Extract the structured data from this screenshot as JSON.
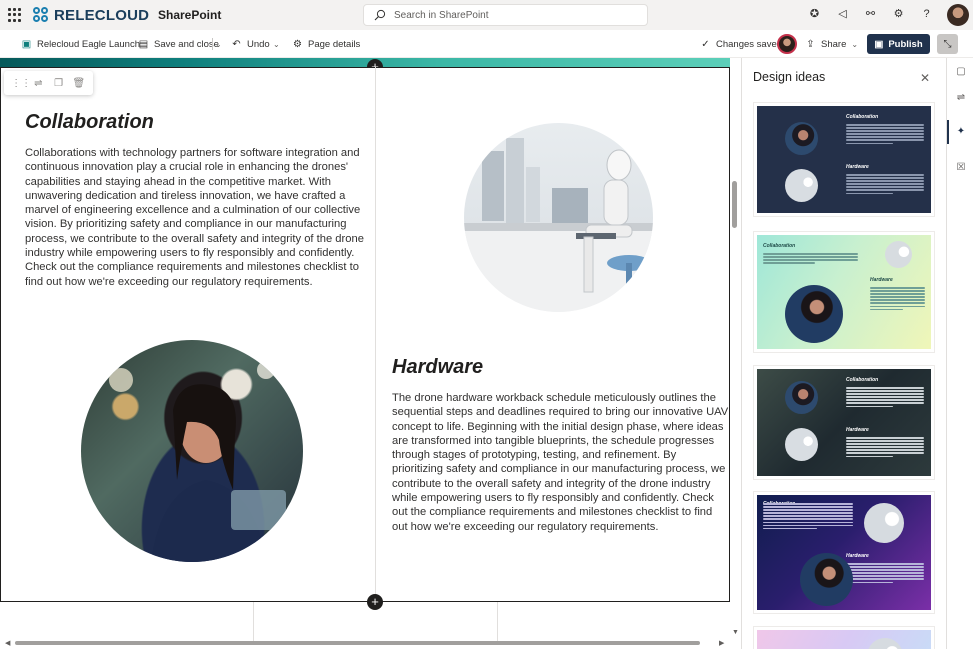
{
  "suite": {
    "brand": "RELECLOUD",
    "app": "SharePoint",
    "search_placeholder": "Search in SharePoint",
    "icons": [
      "copilot-icon",
      "megaphone-icon",
      "share-network-icon",
      "settings-icon",
      "help-icon"
    ]
  },
  "command_bar": {
    "page_name": "Relecloud Eagle Launch",
    "save_close": "Save and close",
    "undo": "Undo",
    "page_details": "Page details",
    "status": "Changes saved",
    "share": "Share",
    "publish": "Publish"
  },
  "content": {
    "left": {
      "title": "Collaboration",
      "body": "Collaborations with technology partners for software integration and continuous innovation play a crucial role in enhancing the drones' capabilities and staying ahead in the competitive market. With unwavering dedication and tireless innovation, we have crafted a marvel of engineering excellence and a culmination of our collective vision. By prioritizing safety and compliance in our manufacturing process, we contribute to the overall safety and integrity of the drone industry while empowering users to fly responsibly and confidently. Check out the compliance requirements and milestones checklist to find out how we're exceeding our regulatory requirements."
    },
    "right": {
      "title": "Hardware",
      "body": "The drone hardware workback schedule meticulously outlines the sequential steps and deadlines required to bring our innovative UAV concept to life. Beginning with the initial design phase, where ideas are transformed into tangible blueprints, the schedule progresses through stages of prototyping, testing, and refinement. By prioritizing safety and compliance in our manufacturing process, we contribute to the overall safety and integrity of the drone industry while empowering users to fly responsibly and confidently. Check out the compliance requirements and milestones checklist to find out how we're exceeding our regulatory requirements."
    }
  },
  "design_ideas": {
    "title": "Design ideas",
    "mini_titles": {
      "collab": "Collaboration",
      "hardware": "Hardware"
    }
  },
  "colors": {
    "accent_dark": "#20324d",
    "teal": "#0f7f7d",
    "danger_ring": "#c4314b"
  }
}
